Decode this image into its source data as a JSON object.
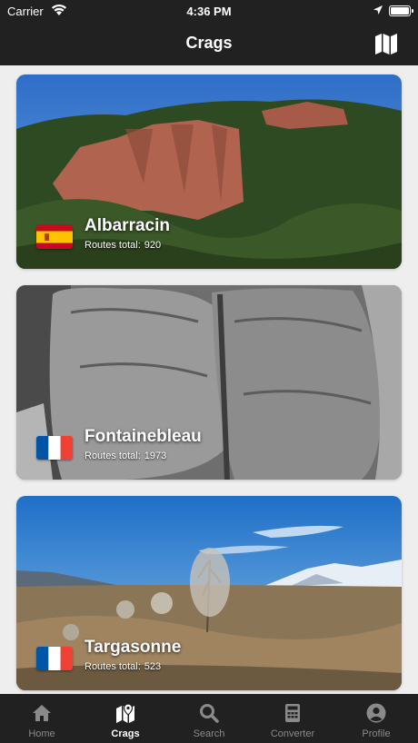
{
  "status_bar": {
    "carrier": "Carrier",
    "time": "4:36 PM",
    "icons": [
      "wifi-icon",
      "location-arrow-icon",
      "battery-icon"
    ]
  },
  "nav_bar": {
    "title": "Crags",
    "right_icon": "map-icon"
  },
  "crags": [
    {
      "name": "Albarracin",
      "routes_label": "Routes total:",
      "routes": "920",
      "flag": "spain-flag"
    },
    {
      "name": "Fontainebleau",
      "routes_label": "Routes total:",
      "routes": "1973",
      "flag": "france-flag"
    },
    {
      "name": "Targasonne",
      "routes_label": "Routes total:",
      "routes": "523",
      "flag": "france-flag"
    }
  ],
  "tab_bar": {
    "tabs": [
      {
        "label": "Home",
        "icon": "home-icon"
      },
      {
        "label": "Crags",
        "icon": "map-marker-icon",
        "active": true
      },
      {
        "label": "Search",
        "icon": "search-icon"
      },
      {
        "label": "Converter",
        "icon": "calculator-icon"
      },
      {
        "label": "Profile",
        "icon": "profile-icon"
      }
    ]
  },
  "colors": {
    "bar_background": "#212121",
    "tab_active": "#ffffff",
    "tab_inactive": "#8a8a8a",
    "list_background": "#eeeeee"
  }
}
